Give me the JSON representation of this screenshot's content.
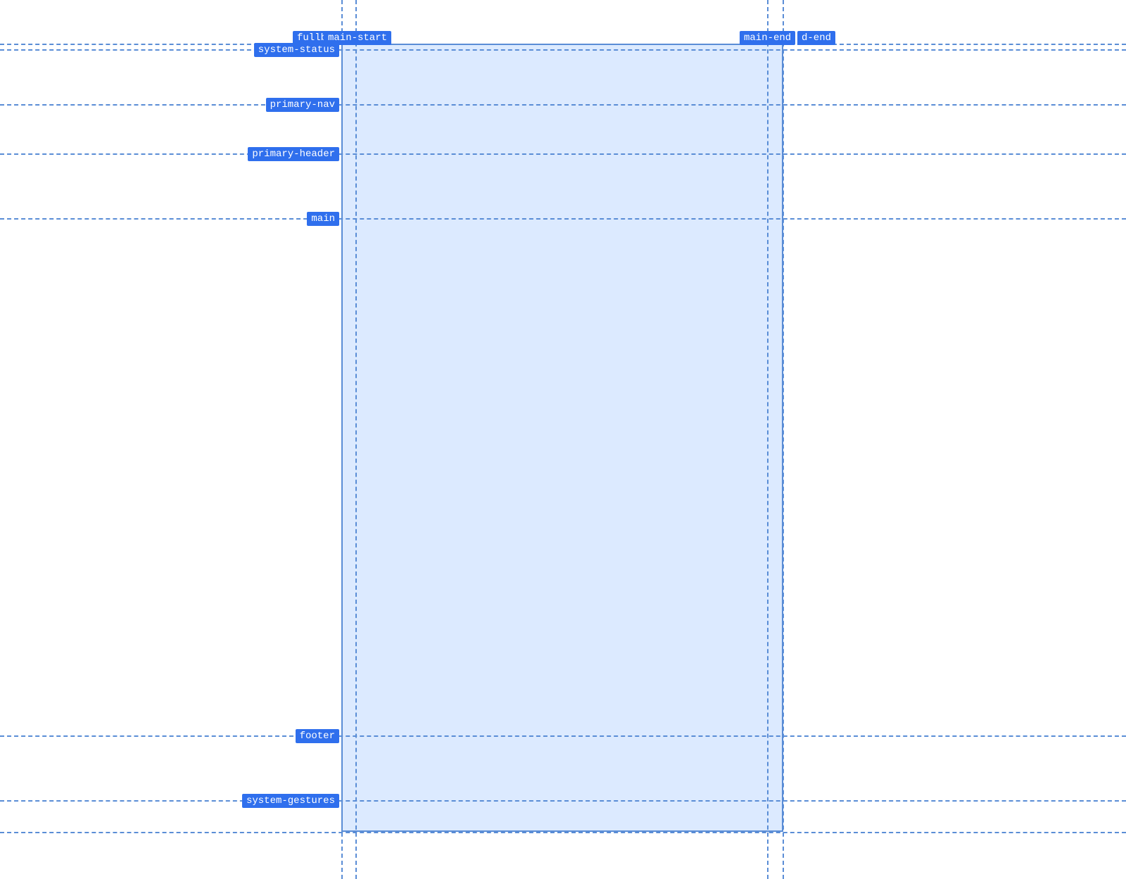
{
  "grid": {
    "columns": {
      "fullbleed_start": "fullbleed-start",
      "main_start": "main-start",
      "main_end": "main-end",
      "fullbleed_end": "fullbleed-end",
      "d_end_fragment": "d-end"
    },
    "rows": {
      "system_status": "system-status",
      "primary_nav": "primary-nav",
      "primary_header": "primary-header",
      "main": "main",
      "footer": "footer",
      "system_gestures": "system-gestures"
    },
    "label_truncated": {
      "fullbleed_start_visible": "fullb"
    }
  },
  "colors": {
    "line": "#5a8dd6",
    "fill": "#dceaff",
    "label_bg": "#2f6fed",
    "label_fg": "#ffffff"
  }
}
